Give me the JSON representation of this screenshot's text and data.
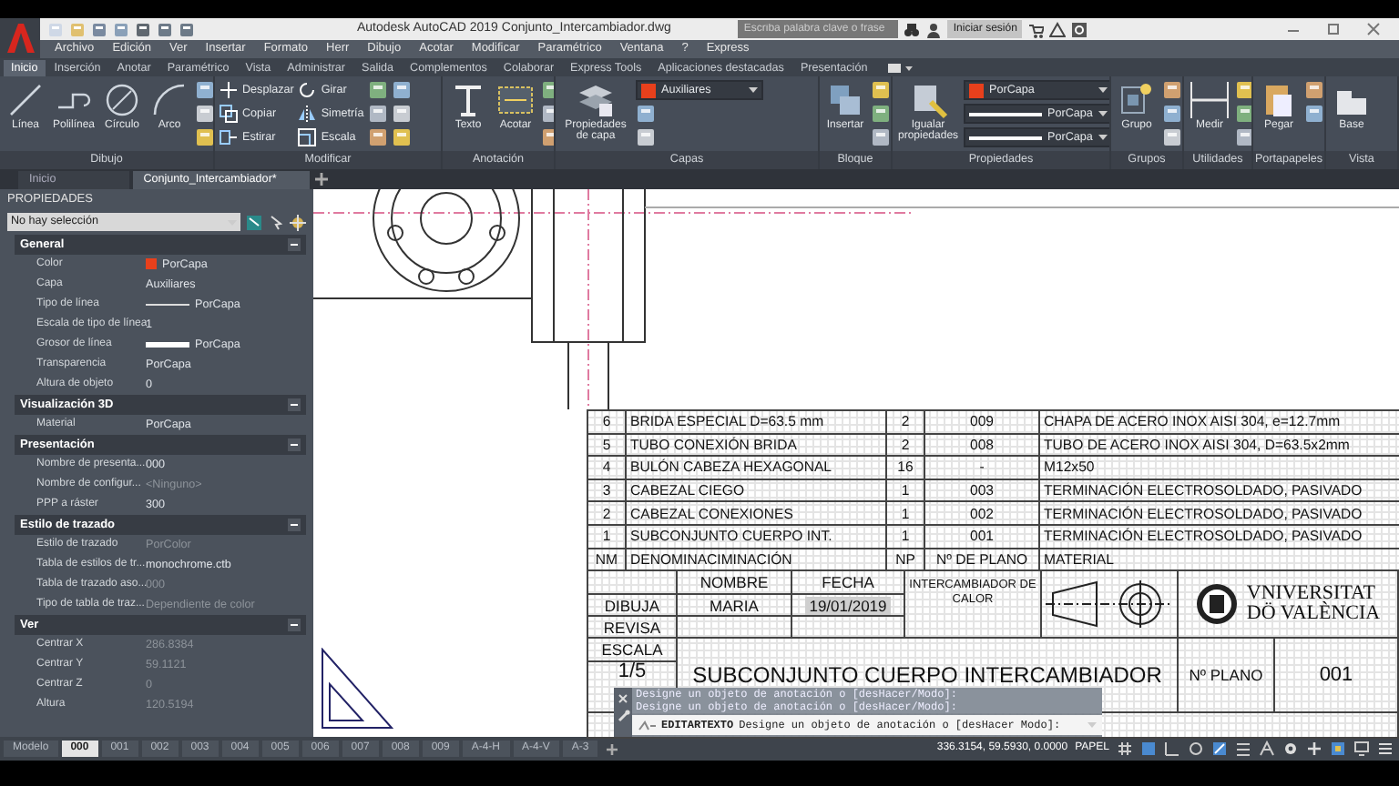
{
  "title_bar": {
    "app_title": "Autodesk AutoCAD 2019",
    "file_name": "Conjunto_Intercambiador.dwg",
    "search": {
      "placeholder": "Escriba palabra clave o frase"
    },
    "sign_in": "Iniciar sesión"
  },
  "menu_bar": [
    "Archivo",
    "Edición",
    "Ver",
    "Insertar",
    "Formato",
    "Herr",
    "Dibujo",
    "Acotar",
    "Modificar",
    "Paramétrico",
    "Ventana",
    "?",
    "Express"
  ],
  "ribbon_tabs": [
    {
      "label": "Inicio",
      "selected": true
    },
    {
      "label": "Inserción",
      "selected": false
    },
    {
      "label": "Anotar",
      "selected": false
    },
    {
      "label": "Paramétrico",
      "selected": false
    },
    {
      "label": "Vista",
      "selected": false
    },
    {
      "label": "Administrar",
      "selected": false
    },
    {
      "label": "Salida",
      "selected": false
    },
    {
      "label": "Complementos",
      "selected": false
    },
    {
      "label": "Colaborar",
      "selected": false
    },
    {
      "label": "Express Tools",
      "selected": false
    },
    {
      "label": "Aplicaciones destacadas",
      "selected": false
    },
    {
      "label": "Presentación",
      "selected": false
    }
  ],
  "ribbon_panels": [
    {
      "label": "Dibujo",
      "columns": [
        [
          {
            "kind": "large",
            "label": "Línea"
          }
        ],
        [
          {
            "kind": "large",
            "label": "Polilínea"
          }
        ],
        [
          {
            "kind": "large",
            "label": "Círculo"
          }
        ],
        [
          {
            "kind": "large",
            "label": "Arco"
          }
        ],
        [
          {
            "kind": "icon"
          },
          {
            "kind": "icon"
          },
          {
            "kind": "icon"
          }
        ]
      ]
    },
    {
      "label": "Modificar",
      "columns": [
        [
          {
            "kind": "small",
            "label": "Desplazar"
          },
          {
            "kind": "small",
            "label": "Copiar"
          },
          {
            "kind": "small",
            "label": "Estirar"
          }
        ],
        [
          {
            "kind": "small",
            "label": "Girar"
          },
          {
            "kind": "small",
            "label": "Simetría"
          },
          {
            "kind": "small",
            "label": "Escala"
          }
        ],
        [
          {
            "kind": "icon"
          },
          {
            "kind": "icon"
          },
          {
            "kind": "icon"
          }
        ],
        [
          {
            "kind": "icon"
          },
          {
            "kind": "icon"
          },
          {
            "kind": "icon"
          }
        ]
      ]
    },
    {
      "label": "Anotación",
      "columns": [
        [
          {
            "kind": "large",
            "label": "Texto"
          }
        ],
        [
          {
            "kind": "large",
            "label": "Acotar"
          }
        ],
        [
          {
            "kind": "icon"
          },
          {
            "kind": "icon"
          },
          {
            "kind": "icon"
          }
        ]
      ]
    },
    {
      "label": "Capas",
      "columns": [
        [
          {
            "kind": "large",
            "label": "Propiedades de capa"
          }
        ],
        [
          {
            "kind": "combo-color",
            "label": "Auxiliares",
            "color": "#e8401c"
          },
          {
            "kind": "icon"
          },
          {
            "kind": "icon"
          }
        ]
      ]
    },
    {
      "label": "Bloque",
      "columns": [
        [
          {
            "kind": "large",
            "label": "Insertar"
          }
        ],
        [
          {
            "kind": "icon"
          },
          {
            "kind": "icon"
          },
          {
            "kind": "icon"
          }
        ]
      ]
    },
    {
      "label": "Propiedades",
      "columns": [
        [
          {
            "kind": "large",
            "label": "Igualar propiedades"
          }
        ],
        [
          {
            "kind": "combo-color",
            "label": "PorCapa",
            "color": "#e8401c"
          },
          {
            "kind": "combo-line",
            "label": "PorCapa"
          },
          {
            "kind": "combo-line",
            "label": "PorCapa"
          }
        ]
      ]
    },
    {
      "label": "Grupos",
      "columns": [
        [
          {
            "kind": "large",
            "label": "Grupo"
          }
        ],
        [
          {
            "kind": "icon"
          },
          {
            "kind": "icon"
          },
          {
            "kind": "icon"
          }
        ]
      ]
    },
    {
      "label": "Utilidades",
      "columns": [
        [
          {
            "kind": "large",
            "label": "Medir"
          }
        ],
        [
          {
            "kind": "icon"
          },
          {
            "kind": "icon"
          },
          {
            "kind": "icon"
          }
        ]
      ]
    },
    {
      "label": "Portapapeles",
      "columns": [
        [
          {
            "kind": "large",
            "label": "Pegar"
          }
        ],
        [
          {
            "kind": "icon"
          },
          {
            "kind": "icon"
          }
        ]
      ]
    },
    {
      "label": "Vista",
      "columns": [
        [
          {
            "kind": "large",
            "label": "Base"
          }
        ]
      ]
    }
  ],
  "document_tabs": [
    {
      "label": "Inicio",
      "selected": false
    },
    {
      "label": "Conjunto_Intercambiador*",
      "selected": true
    }
  ],
  "properties": {
    "title": "PROPIEDADES",
    "selection": "No hay selección",
    "sections": [
      {
        "title": "General",
        "rows": [
          {
            "label": "Color",
            "value": "PorCapa",
            "kind": "color",
            "color": "#e8401c",
            "disabled": false
          },
          {
            "label": "Capa",
            "value": "Auxiliares",
            "kind": "text",
            "disabled": false
          },
          {
            "label": "Tipo de línea",
            "value": "PorCapa",
            "kind": "line",
            "disabled": false
          },
          {
            "label": "Escala de tipo de línea",
            "value": "1",
            "kind": "text",
            "disabled": false
          },
          {
            "label": "Grosor de línea",
            "value": "PorCapa",
            "kind": "thick-line",
            "disabled": false
          },
          {
            "label": "Transparencia",
            "value": "PorCapa",
            "kind": "text",
            "disabled": false
          },
          {
            "label": "Altura de objeto",
            "value": "0",
            "kind": "text",
            "disabled": false
          }
        ]
      },
      {
        "title": "Visualización 3D",
        "rows": [
          {
            "label": "Material",
            "value": "PorCapa",
            "kind": "text",
            "disabled": false
          }
        ]
      },
      {
        "title": "Presentación",
        "rows": [
          {
            "label": "Nombre de presenta...",
            "value": "000",
            "kind": "text",
            "disabled": false
          },
          {
            "label": "Nombre de configur...",
            "value": "<Ninguno>",
            "kind": "text",
            "disabled": true
          },
          {
            "label": "PPP a ráster",
            "value": "300",
            "kind": "text",
            "disabled": false
          }
        ]
      },
      {
        "title": "Estilo de trazado",
        "rows": [
          {
            "label": "Estilo de trazado",
            "value": "PorColor",
            "kind": "text",
            "disabled": true
          },
          {
            "label": "Tabla de estilos de tr...",
            "value": "monochrome.ctb",
            "kind": "text",
            "disabled": false
          },
          {
            "label": "Tabla de trazado aso...",
            "value": "000",
            "kind": "text",
            "disabled": true
          },
          {
            "label": "Tipo de tabla de traz...",
            "value": "Dependiente de color",
            "kind": "text",
            "disabled": true
          }
        ]
      },
      {
        "title": "Ver",
        "rows": [
          {
            "label": "Centrar X",
            "value": "286.8384",
            "kind": "text",
            "disabled": true
          },
          {
            "label": "Centrar Y",
            "value": "59.1121",
            "kind": "text",
            "disabled": true
          },
          {
            "label": "Centrar Z",
            "value": "0",
            "kind": "text",
            "disabled": true
          },
          {
            "label": "Altura",
            "value": "120.5194",
            "kind": "text",
            "disabled": true
          }
        ]
      }
    ]
  },
  "parts_list": {
    "rows": [
      [
        "6",
        "BRIDA ESPECIAL D=63.5 mm",
        "2",
        "009",
        "CHAPA DE ACERO INOX AISI 304, e=12.7mm"
      ],
      [
        "5",
        "TUBO CONEXIÓN BRIDA",
        "2",
        "008",
        "TUBO DE ACERO INOX AISI 304, D=63.5x2mm"
      ],
      [
        "4",
        "BULÓN CABEZA HEXAGONAL",
        "16",
        "-",
        "M12x50"
      ],
      [
        "3",
        "CABEZAL CIEGO",
        "1",
        "003",
        "TERMINACIÓN ELECTROSOLDADO, PASIVADO"
      ],
      [
        "2",
        "CABEZAL CONEXIONES",
        "1",
        "002",
        "TERMINACIÓN ELECTROSOLDADO, PASIVADO"
      ],
      [
        "1",
        "SUBCONJUNTO CUERPO INT.",
        "1",
        "001",
        "TERMINACIÓN ELECTROSOLDADO, PASIVADO"
      ]
    ],
    "header": [
      "NM",
      "DENOMINACIMINACIÓN",
      "NP",
      "Nº DE PLANO",
      "MATERIAL"
    ]
  },
  "title_block": {
    "name_header": "NOMBRE",
    "date_header": "FECHA",
    "drawn_label": "DIBUJA",
    "drawn_name": "MARIA",
    "drawn_date": "19/01/2019",
    "reviewed_label": "REVISA",
    "scale_label": "ESCALA",
    "scale": "1/5",
    "project": "INTERCAMBIADOR DE CALOR",
    "university_line_1": "VNIVERSITAT",
    "university_line_2": "DÖ VALÈNCIA",
    "drawing_title": "SUBCONJUNTO CUERPO INTERCAMBIADOR",
    "drawing_number_label": "Nº PLANO",
    "drawing_number": "001"
  },
  "command_line": {
    "history": [
      "Designe un objeto de anotación o [desHacer/Modo]:",
      "Designe un objeto de anotación o [desHacer/Modo]:"
    ],
    "command": "EDITARTEXTO",
    "prompt": "Designe un objeto de anotación o [desHacer Modo]:"
  },
  "layout_tabs": [
    {
      "label": "Modelo",
      "selected": false
    },
    {
      "label": "000",
      "selected": true
    },
    {
      "label": "001",
      "selected": false
    },
    {
      "label": "002",
      "selected": false
    },
    {
      "label": "003",
      "selected": false
    },
    {
      "label": "004",
      "selected": false
    },
    {
      "label": "005",
      "selected": false
    },
    {
      "label": "006",
      "selected": false
    },
    {
      "label": "007",
      "selected": false
    },
    {
      "label": "008",
      "selected": false
    },
    {
      "label": "009",
      "selected": false
    },
    {
      "label": "A-4-H",
      "selected": false
    },
    {
      "label": "A-4-V",
      "selected": false
    },
    {
      "label": "A-3",
      "selected": false
    }
  ],
  "status_bar": {
    "coordinates": "336.3154, 59.5930, 0.0000",
    "space": "PAPEL"
  }
}
